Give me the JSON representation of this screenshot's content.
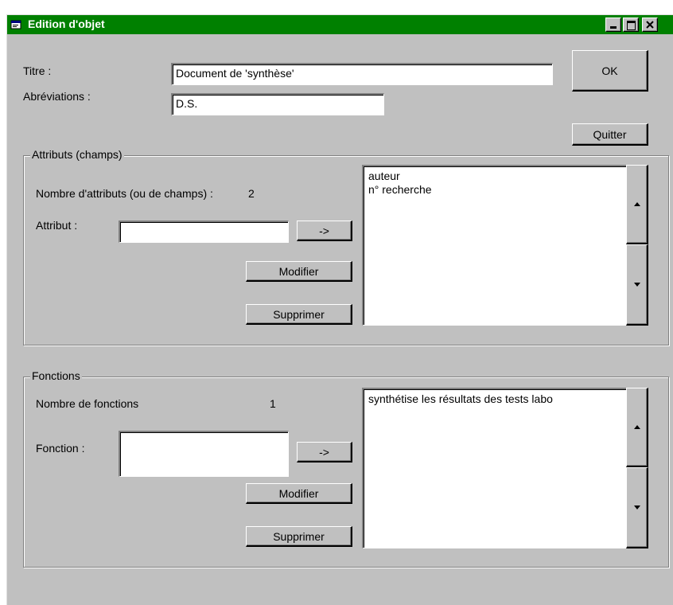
{
  "window": {
    "title": "Edition d'objet",
    "title_bar_color": "#008000",
    "controls": [
      "minimize-icon",
      "maximize-icon",
      "close-icon"
    ]
  },
  "header": {
    "titre_label": "Titre :",
    "titre_value": "Document de 'synthèse'",
    "abrev_label": "Abréviations :",
    "abrev_value": "D.S.",
    "ok_label": "OK",
    "quitter_label": "Quitter"
  },
  "attributs": {
    "group_label": "Attributs (champs)",
    "count_label": "Nombre d'attributs (ou de champs) :",
    "count_value": "2",
    "field_label": "Attribut :",
    "field_value": "",
    "add_label": "->",
    "modify_label": "Modifier",
    "delete_label": "Supprimer",
    "items": [
      "auteur",
      "n° recherche"
    ]
  },
  "fonctions": {
    "group_label": "Fonctions",
    "count_label": "Nombre de fonctions",
    "count_value": "1",
    "field_label": "Fonction :",
    "field_value": "",
    "add_label": "->",
    "modify_label": "Modifier",
    "delete_label": "Supprimer",
    "items": [
      "synthétise les résultats des tests labo"
    ]
  }
}
